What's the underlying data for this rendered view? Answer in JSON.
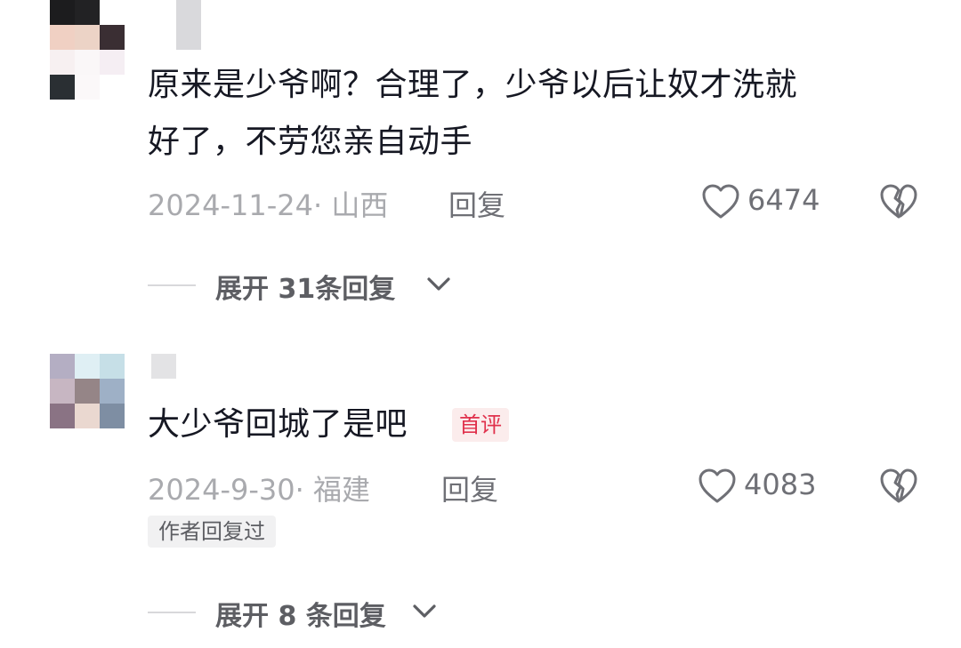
{
  "comments": [
    {
      "text_line1": "原来是少爷啊？合理了，少爷以后让奴才洗就",
      "text_line2": "好了，不劳您亲自动手",
      "date_location": "2024-11-24· 山西",
      "reply_label": "回复",
      "likes": "6474",
      "expand_label": "展开 31条回复"
    },
    {
      "text": "大少爷回城了是吧",
      "badge": "首评",
      "date_location": "2024-9-30· 福建",
      "reply_label": "回复",
      "likes": "4083",
      "author_replied": "作者回复过",
      "expand_label": "展开 8 条回复"
    }
  ],
  "icons": {
    "like": "heart-outline-icon",
    "dislike": "broken-heart-icon",
    "expand": "chevron-down-icon"
  },
  "colors": {
    "text": "#161823",
    "meta": "#a9aaae",
    "badge_red": "#e0314c",
    "badge_bg": "#fbecec"
  }
}
